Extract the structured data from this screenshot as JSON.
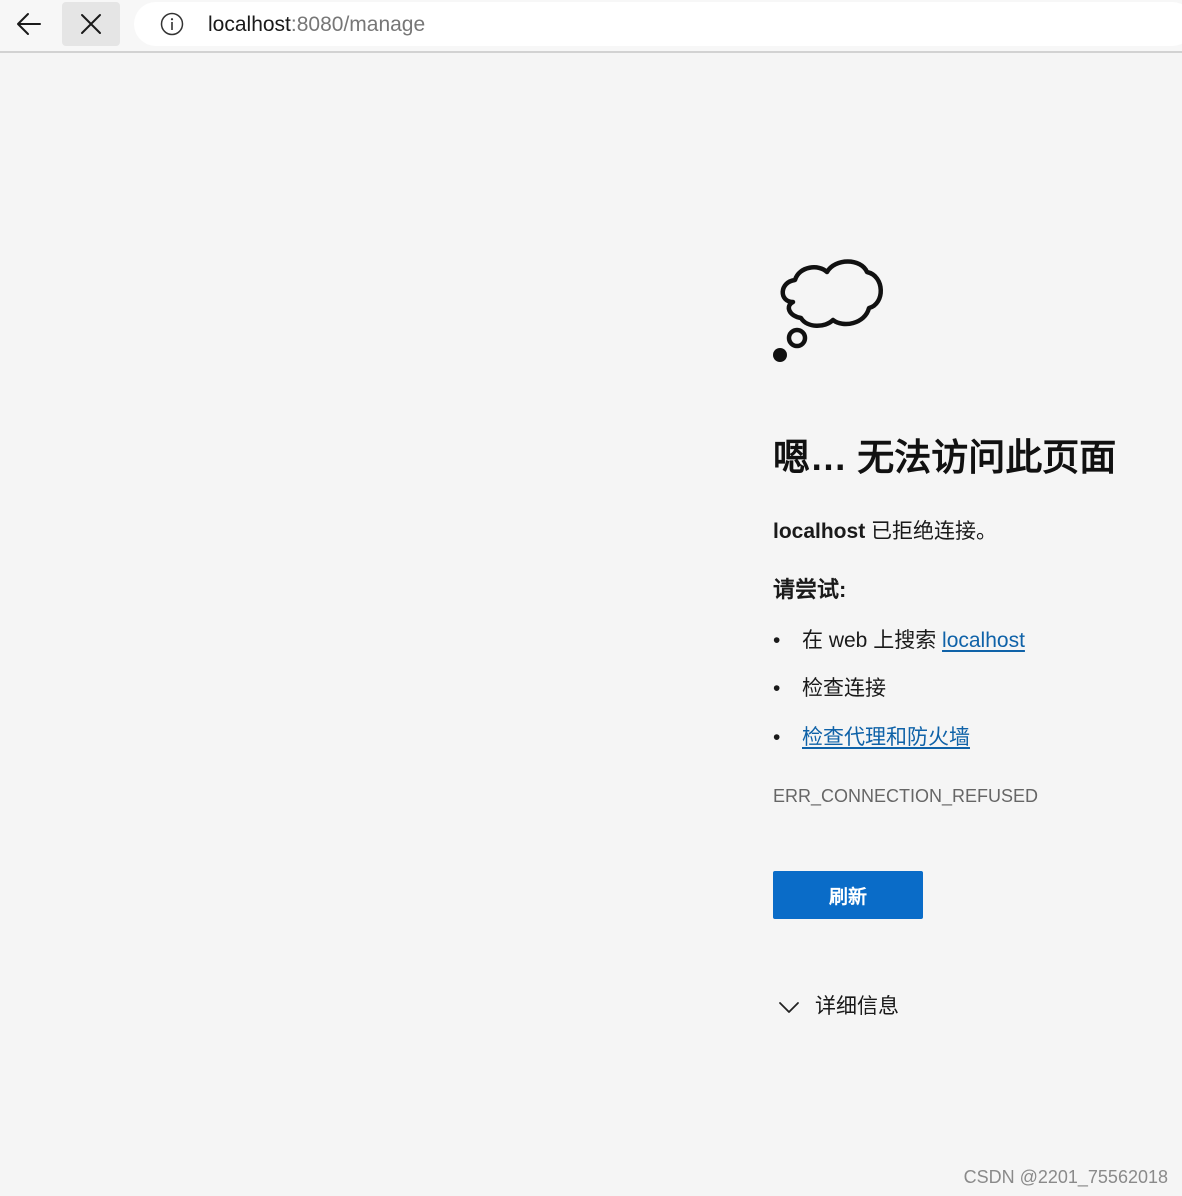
{
  "browser": {
    "back_icon": "arrow-left-icon",
    "stop_icon": "close-icon",
    "info_icon": "info-icon",
    "url_host": "localhost",
    "url_path": ":8080/manage"
  },
  "error_page": {
    "icon": "thought-cloud-icon",
    "title": "嗯… 无法访问此页面",
    "desc_host": "localhost",
    "desc_text": " 已拒绝连接。",
    "try_heading": "请尝试:",
    "suggestions": [
      {
        "bullet": "•",
        "prefix": "在 web 上搜索 ",
        "link": "localhost"
      },
      {
        "bullet": "•",
        "text": "检查连接"
      },
      {
        "bullet": "•",
        "link": "检查代理和防火墙"
      }
    ],
    "error_code": "ERR_CONNECTION_REFUSED",
    "refresh_label": "刷新",
    "details_label": "详细信息",
    "accent_color": "#0a6cc8",
    "link_color": "#0f62a8"
  },
  "watermark": "CSDN @2201_75562018"
}
